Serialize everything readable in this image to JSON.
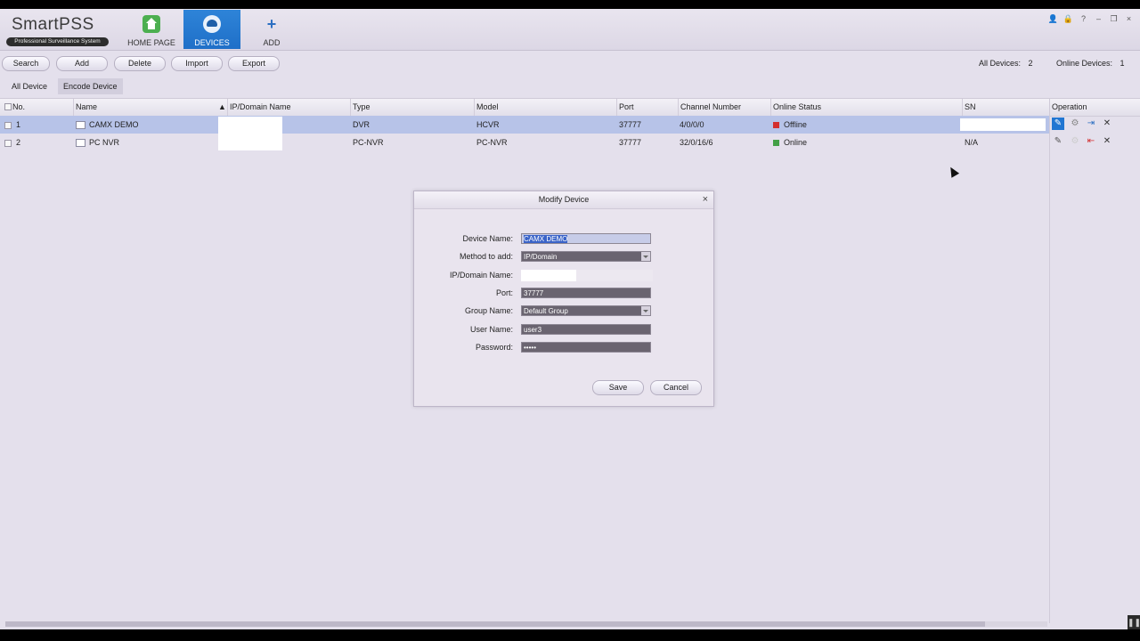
{
  "app": {
    "logo_title": "SmartPSS",
    "logo_subtitle": "Professional Surveillance System"
  },
  "nav": [
    {
      "label": "HOME PAGE",
      "icon": "home-icon"
    },
    {
      "label": "DEVICES",
      "icon": "devices-icon"
    },
    {
      "label": "ADD",
      "icon": "add-icon"
    }
  ],
  "window_controls": [
    "👤",
    "🔒",
    "?",
    "–",
    "❐",
    "×"
  ],
  "toolbar": {
    "search": "Search",
    "add": "Add",
    "delete": "Delete",
    "import": "Import",
    "export": "Export",
    "all_devices_label": "All Devices:",
    "all_devices_count": "2",
    "online_devices_label": "Online Devices:",
    "online_devices_count": "1"
  },
  "tabs": [
    "All Device",
    "Encode Device"
  ],
  "table": {
    "headers": [
      "No.",
      "Name",
      "IP/Domain Name",
      "Type",
      "Model",
      "Port",
      "Channel Number",
      "Online Status",
      "SN",
      "Operation"
    ],
    "sort_indicator": "▲",
    "rows": [
      {
        "no": "1",
        "name": "CAMX DEMO",
        "type": "DVR",
        "model": "HCVR",
        "port": "37777",
        "channels": "4/0/0/0",
        "status": "Offline",
        "status_color": "#d32f2f",
        "sn": ""
      },
      {
        "no": "2",
        "name": "PC NVR",
        "type": "PC-NVR",
        "model": "PC-NVR",
        "port": "37777",
        "channels": "32/0/16/6",
        "status": "Online",
        "status_color": "#43a047",
        "sn": "N/A"
      }
    ]
  },
  "dialog": {
    "title": "Modify Device",
    "close": "×",
    "device_name_label": "Device Name:",
    "device_name_value": "CAMX DEMO",
    "method_label": "Method to add:",
    "method_value": "IP/Domain",
    "ip_label": "IP/Domain Name:",
    "port_label": "Port:",
    "port_value": "37777",
    "group_label": "Group Name:",
    "group_value": "Default Group",
    "user_label": "User Name:",
    "user_value": "user3",
    "password_label": "Password:",
    "password_value": "•••••",
    "save": "Save",
    "cancel": "Cancel"
  },
  "accent_color": "#2176d2"
}
